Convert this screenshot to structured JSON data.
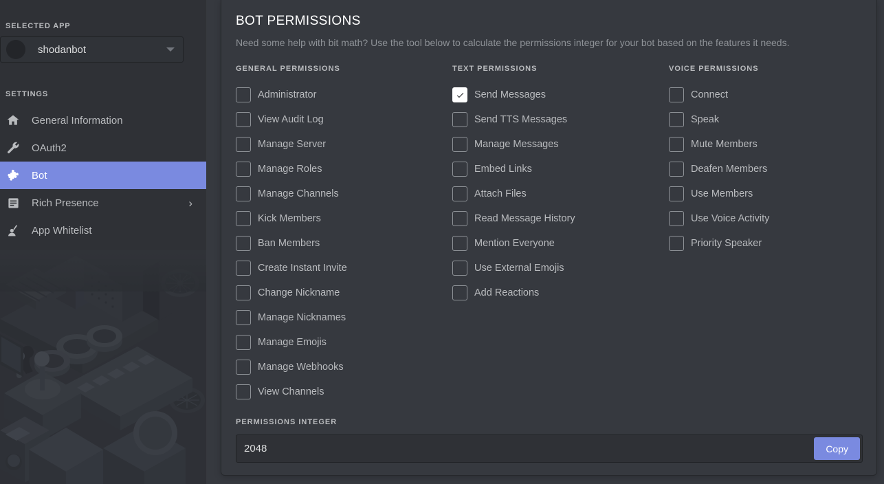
{
  "sidebar": {
    "selected_app_label": "SELECTED APP",
    "app": {
      "name": "shodanbot",
      "avatar_icon": "app-avatar-circle",
      "caret_icon": "chevron-down-icon"
    },
    "settings_label": "SETTINGS",
    "items": [
      {
        "label": "General Information",
        "icon": "home-icon",
        "active": false,
        "chevron": ""
      },
      {
        "label": "OAuth2",
        "icon": "wrench-icon",
        "active": false,
        "chevron": ""
      },
      {
        "label": "Bot",
        "icon": "puzzle-piece-icon",
        "active": true,
        "chevron": ""
      },
      {
        "label": "Rich Presence",
        "icon": "list-document-icon",
        "active": false,
        "chevron": "›"
      },
      {
        "label": "App Whitelist",
        "icon": "person-raised-hand-icon",
        "active": false,
        "chevron": ""
      }
    ]
  },
  "main": {
    "title": "BOT PERMISSIONS",
    "subtitle": "Need some help with bit math? Use the tool below to calculate the permissions integer for your bot based on the features it needs.",
    "columns": [
      {
        "header": "GENERAL PERMISSIONS",
        "permissions": [
          {
            "label": "Administrator",
            "checked": false
          },
          {
            "label": "View Audit Log",
            "checked": false
          },
          {
            "label": "Manage Server",
            "checked": false
          },
          {
            "label": "Manage Roles",
            "checked": false
          },
          {
            "label": "Manage Channels",
            "checked": false
          },
          {
            "label": "Kick Members",
            "checked": false
          },
          {
            "label": "Ban Members",
            "checked": false
          },
          {
            "label": "Create Instant Invite",
            "checked": false
          },
          {
            "label": "Change Nickname",
            "checked": false
          },
          {
            "label": "Manage Nicknames",
            "checked": false
          },
          {
            "label": "Manage Emojis",
            "checked": false
          },
          {
            "label": "Manage Webhooks",
            "checked": false
          },
          {
            "label": "View Channels",
            "checked": false
          }
        ]
      },
      {
        "header": "TEXT PERMISSIONS",
        "permissions": [
          {
            "label": "Send Messages",
            "checked": true
          },
          {
            "label": "Send TTS Messages",
            "checked": false
          },
          {
            "label": "Manage Messages",
            "checked": false
          },
          {
            "label": "Embed Links",
            "checked": false
          },
          {
            "label": "Attach Files",
            "checked": false
          },
          {
            "label": "Read Message History",
            "checked": false
          },
          {
            "label": "Mention Everyone",
            "checked": false
          },
          {
            "label": "Use External Emojis",
            "checked": false
          },
          {
            "label": "Add Reactions",
            "checked": false
          }
        ]
      },
      {
        "header": "VOICE PERMISSIONS",
        "permissions": [
          {
            "label": "Connect",
            "checked": false
          },
          {
            "label": "Speak",
            "checked": false
          },
          {
            "label": "Mute Members",
            "checked": false
          },
          {
            "label": "Deafen Members",
            "checked": false
          },
          {
            "label": "Use Members",
            "checked": false
          },
          {
            "label": "Use Voice Activity",
            "checked": false
          },
          {
            "label": "Priority Speaker",
            "checked": false
          }
        ]
      }
    ],
    "integer": {
      "label": "PERMISSIONS INTEGER",
      "value": "2048",
      "placeholder": "0",
      "copy_label": "Copy"
    }
  },
  "colors": {
    "accent": "#7a8ae0",
    "card_bg": "#36393f",
    "sidebar_bg": "#2f3136",
    "text_muted": "#b9bbbe",
    "text_bright": "#ffffff",
    "input_bg": "#2f3136",
    "border": "#202225"
  }
}
